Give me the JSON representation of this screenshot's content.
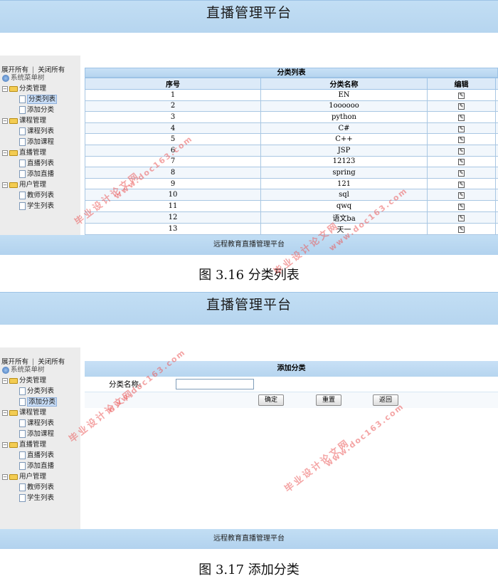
{
  "app_title": "直播管理平台",
  "footer_text": "远程教育直播管理平台",
  "sidebar": {
    "expand_all": "展开所有",
    "separator": "|",
    "collapse_all": "关闭所有",
    "root": "系统菜单树",
    "groups": [
      {
        "label": "分类管理",
        "items": [
          "分类列表",
          "添加分类"
        ]
      },
      {
        "label": "课程管理",
        "items": [
          "课程列表",
          "添加课程"
        ]
      },
      {
        "label": "直播管理",
        "items": [
          "直播列表",
          "添加直播"
        ]
      },
      {
        "label": "用户管理",
        "items": [
          "教师列表",
          "学生列表"
        ]
      }
    ]
  },
  "list_panel": {
    "title": "分类列表",
    "columns": [
      "序号",
      "分类名称",
      "编辑"
    ],
    "rows": [
      {
        "no": "1",
        "name": "EN"
      },
      {
        "no": "2",
        "name": "1oooooo"
      },
      {
        "no": "3",
        "name": "python"
      },
      {
        "no": "4",
        "name": "C#"
      },
      {
        "no": "5",
        "name": "C++"
      },
      {
        "no": "6",
        "name": "JSP"
      },
      {
        "no": "7",
        "name": "12123"
      },
      {
        "no": "8",
        "name": "spring"
      },
      {
        "no": "9",
        "name": "121"
      },
      {
        "no": "10",
        "name": "sql"
      },
      {
        "no": "11",
        "name": "qwq"
      },
      {
        "no": "12",
        "name": "语文ba"
      },
      {
        "no": "13",
        "name": "天一"
      }
    ],
    "caption": "图 3.16  分类列表"
  },
  "add_panel": {
    "title": "添加分类",
    "field_label": "分类名称:",
    "field_value": "",
    "buttons": {
      "confirm": "确定",
      "reset": "重置",
      "back": "返回"
    },
    "caption": "图 3.17  添加分类"
  },
  "watermark": {
    "cn": "毕业设计论文网",
    "url": "www.doc163.com"
  }
}
